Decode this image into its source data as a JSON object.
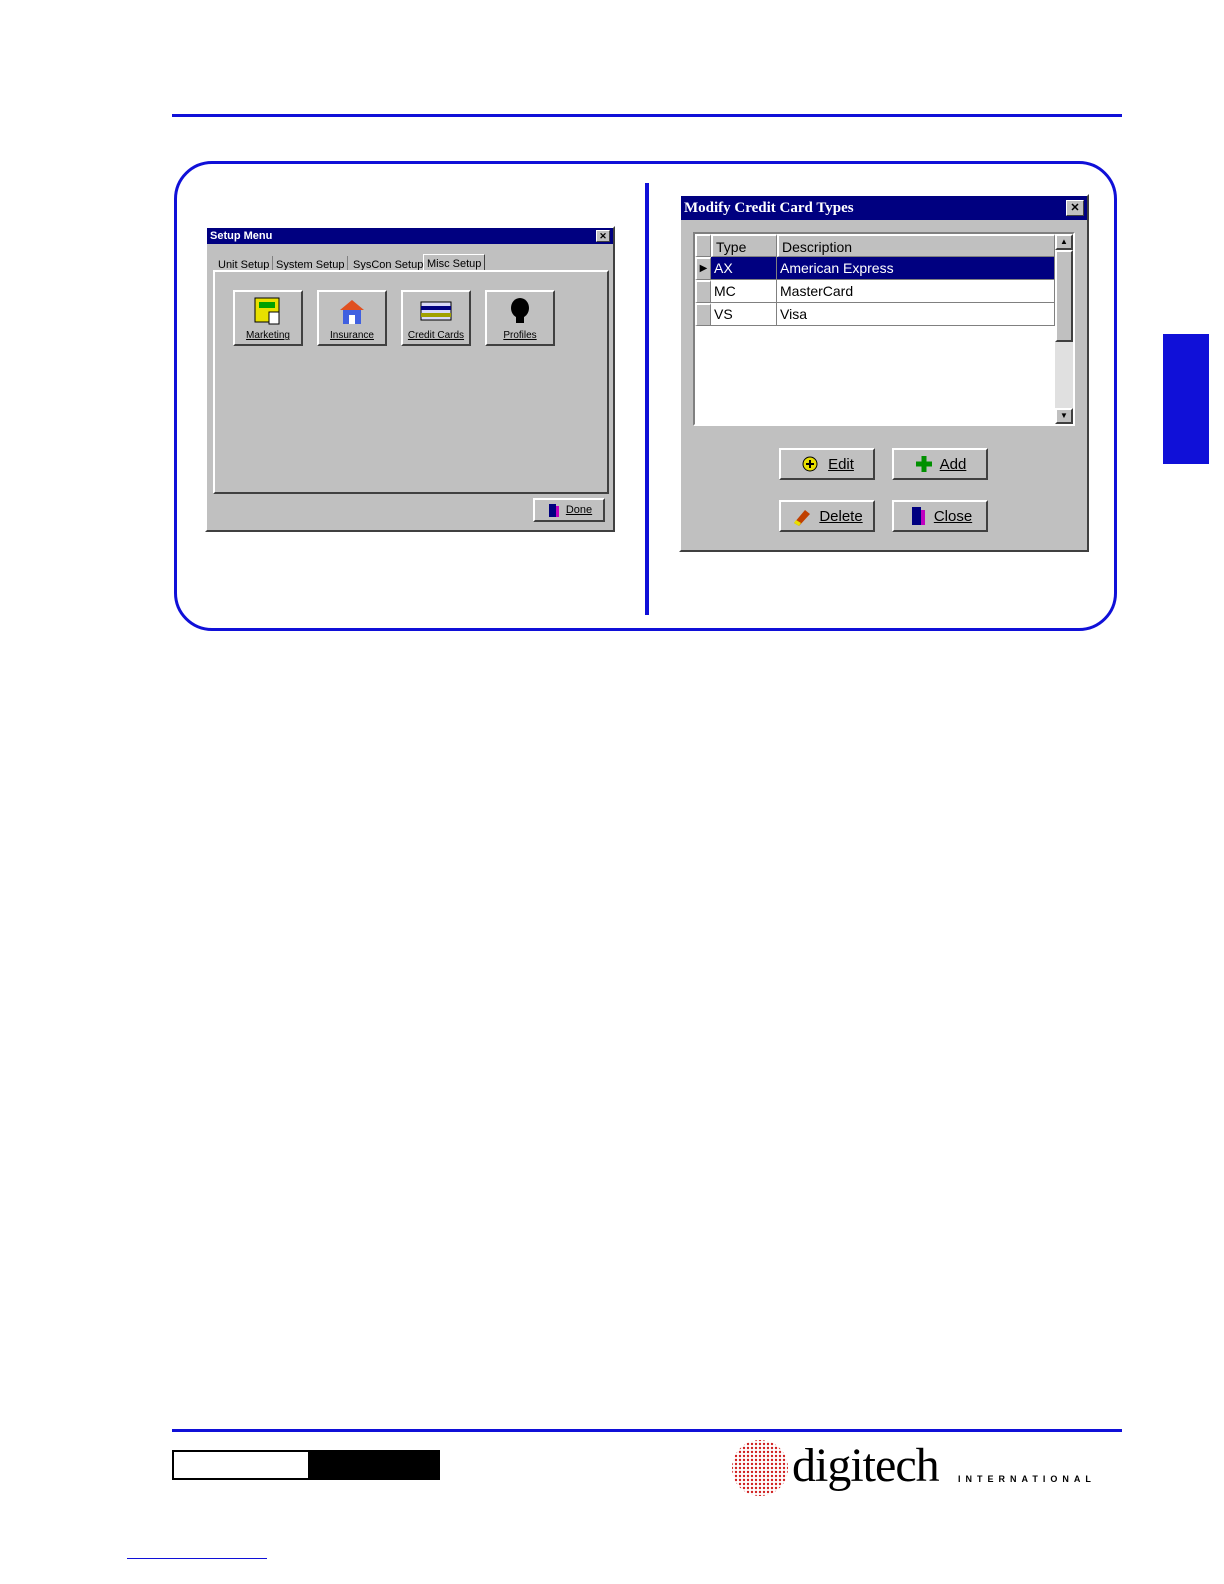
{
  "setup_menu": {
    "title": "Setup Menu",
    "tabs": [
      "Unit Setup",
      "System Setup",
      "SysCon Setup",
      "Misc Setup"
    ],
    "active_tab": "Misc Setup",
    "icon_buttons": [
      {
        "label": "Marketing",
        "icon": "marketing-icon"
      },
      {
        "label": "Insurance",
        "icon": "insurance-icon"
      },
      {
        "label": "Credit Cards",
        "icon": "credit-card-icon"
      },
      {
        "label": "Profiles",
        "icon": "profile-head-icon"
      }
    ],
    "done_label": "Done"
  },
  "credit_card_dialog": {
    "title": "Modify Credit Card Types",
    "columns": [
      "Type",
      "Description"
    ],
    "rows": [
      {
        "type": "AX",
        "description": "American Express",
        "selected": true
      },
      {
        "type": "MC",
        "description": "MasterCard",
        "selected": false
      },
      {
        "type": "VS",
        "description": "Visa",
        "selected": false
      }
    ],
    "buttons": {
      "edit": "Edit",
      "add": "Add",
      "delete": "Delete",
      "close": "Close"
    }
  },
  "footer": {
    "logo_text": "digitech",
    "logo_sub": "INTERNATIONAL"
  },
  "colors": {
    "accent": "#1010d8",
    "titlebar": "#000080",
    "window": "#c0c0c0"
  }
}
